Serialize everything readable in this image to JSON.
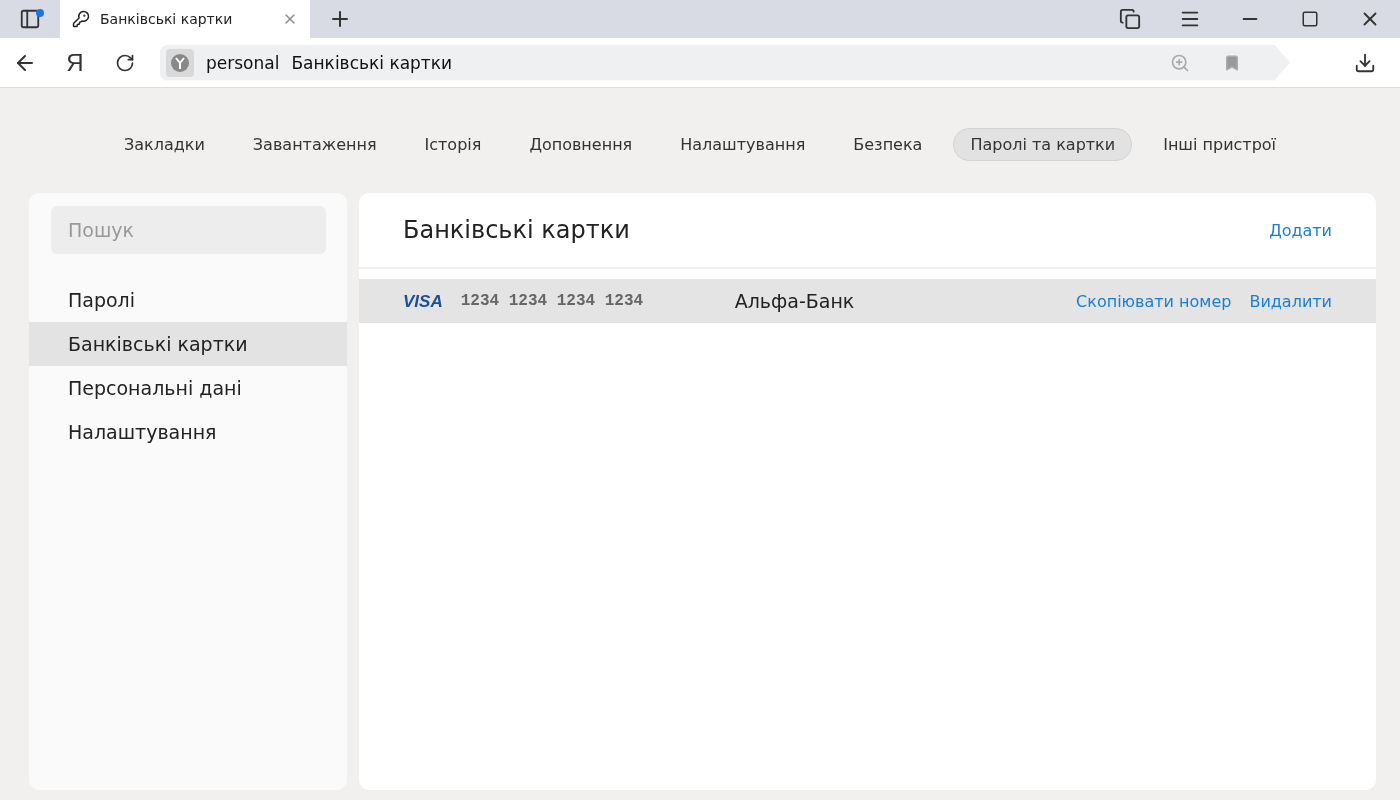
{
  "browser": {
    "tab_title": "Банківські картки",
    "logo_letter": "Я",
    "address": {
      "host": "personal",
      "page": "Банківські картки"
    }
  },
  "nav": [
    {
      "label": "Закладки",
      "selected": false
    },
    {
      "label": "Завантаження",
      "selected": false
    },
    {
      "label": "Історія",
      "selected": false
    },
    {
      "label": "Доповнення",
      "selected": false
    },
    {
      "label": "Налаштування",
      "selected": false
    },
    {
      "label": "Безпека",
      "selected": false
    },
    {
      "label": "Паролі та картки",
      "selected": true
    },
    {
      "label": "Інші пристрої",
      "selected": false
    }
  ],
  "sidebar": {
    "search": {
      "placeholder": "Пошук"
    },
    "items": [
      {
        "label": "Паролі",
        "selected": false
      },
      {
        "label": "Банківські картки",
        "selected": true
      },
      {
        "label": "Персональні дані",
        "selected": false
      },
      {
        "label": "Налаштування",
        "selected": false
      }
    ]
  },
  "main": {
    "title": "Банківські картки",
    "add_link": "Додати",
    "cards": [
      {
        "brand": "VISA",
        "number": "1234 1234 1234 1234",
        "bank": "Альфа-Банк",
        "selected": true,
        "actions": [
          "Скопіювати номер",
          "Видалити"
        ]
      }
    ]
  }
}
